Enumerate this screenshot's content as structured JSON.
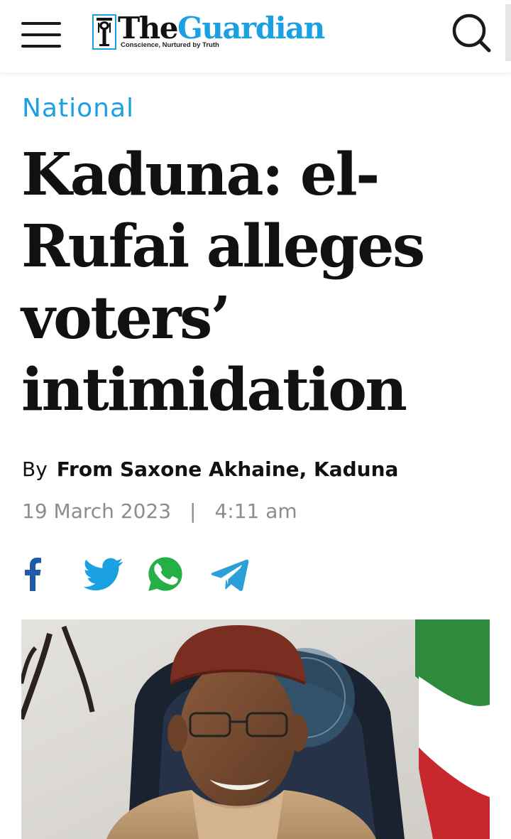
{
  "header": {
    "logo": {
      "the": "The",
      "guardian": "Guardian",
      "tagline": "Conscience, Nurtured by Truth"
    },
    "menu_icon": "hamburger-menu-icon",
    "search_icon": "search-icon"
  },
  "article": {
    "category": "National",
    "headline": "Kaduna: el-Rufai alleges voters’ intimidation",
    "byline_prefix": "By",
    "author": "From Saxone Akhaine, Kaduna",
    "date": "19 March 2023",
    "separator": "|",
    "time": "4:11 am"
  },
  "share": [
    {
      "name": "facebook-icon",
      "color": "#1d5ba8"
    },
    {
      "name": "twitter-icon",
      "color": "#1ba0e2"
    },
    {
      "name": "whatsapp-icon",
      "color": "#25b045"
    },
    {
      "name": "telegram-icon",
      "color": "#2a9fd8"
    }
  ],
  "colors": {
    "accent": "#1ba0e2",
    "text": "#111111",
    "muted": "#8c8c8c"
  }
}
